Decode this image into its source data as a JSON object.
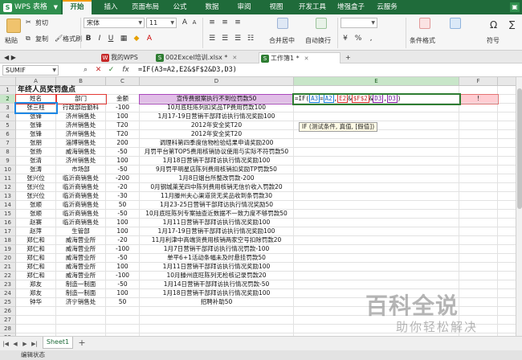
{
  "app": {
    "name": "WPS 表格",
    "menu_tabs": [
      "开始",
      "插入",
      "页面布局",
      "公式",
      "数据",
      "审阅",
      "视图",
      "开发工具",
      "增强盒子",
      "云服务"
    ],
    "active_tab": "开始"
  },
  "ribbon": {
    "cut": "剪切",
    "copy": "复制",
    "format_painter": "格式刷",
    "paste": "粘贴",
    "font_name": "宋体",
    "font_size": "11",
    "merge_center": "合并居中",
    "wrap": "自动换行",
    "cond_format": "条件格式",
    "symbol": "符号",
    "bold": "B",
    "italic": "I",
    "underline": "U"
  },
  "doc_tabs": [
    "我的WPS",
    "002Excel培训.xlsx *",
    "工作簿1 *"
  ],
  "formula_bar": {
    "name_box": "SUMIF",
    "formula": "=IF(A3=A2,E2&$F$2&D3,D3)"
  },
  "columns": [
    "A",
    "B",
    "C",
    "D",
    "E",
    "F"
  ],
  "sheet": {
    "title": "年终人员奖罚盘点",
    "headers": {
      "name": "姓名",
      "dept": "部门",
      "amount": "金额",
      "note": "备注",
      "total": "合计"
    },
    "rows": [
      [
        "张三柱",
        "行政部后勤科",
        "-50",
        "宣传费报案执行不到位罚款50"
      ],
      [
        "张三柱",
        "行政部后勤科",
        "-100",
        "10月底旺陈列扣奖品TP费用罚款100"
      ],
      [
        "张锋",
        "济州销售处",
        "100",
        "1月17-19日营销干部拜访执行情况奖励100"
      ],
      [
        "张锋",
        "济州销售处",
        "T20",
        "2012年安全奖T20"
      ],
      [
        "张锋",
        "济州销售处",
        "T20",
        "2012年安全奖T20"
      ],
      [
        "张朋",
        "淄博销售处",
        "200",
        "调理科第四季度信物检验结果申请奖励200"
      ],
      [
        "张扬",
        "威海销售处",
        "-50",
        "月罚平台第TOP5费用核销协议使用与实际不符罚款50"
      ],
      [
        "张清",
        "济州销售处",
        "100",
        "1月18日营销干部拜访执行情况奖励100"
      ],
      [
        "张涛",
        "市场部",
        "-50",
        "9月罚平明星店陈列费用核销扣奖励TP罚款50"
      ],
      [
        "张兴位",
        "临沂商销售处",
        "-200",
        "1月8日烟台所整改罚款-200"
      ],
      [
        "张兴位",
        "临沂商销售处",
        "-20",
        "0月钢城莱芜四中陈列费用核销无信价收入罚款20"
      ],
      [
        "张兴位",
        "临沂商销售处",
        "-30",
        "11月滕州夫心渠道货无奖品收到条罚款30"
      ],
      [
        "张顺",
        "临沂商销售处",
        "50",
        "1月23-25日营销干部拜访执行情况奖励50"
      ],
      [
        "张顺",
        "临沂商销售处",
        "-50",
        "10月底旺陈列专案抽查近数据不一致力度不够罚款50"
      ],
      [
        "赵赛",
        "临沂商销售处",
        "100",
        "1月11日营销干部拜访执行情况奖励100"
      ],
      [
        "赵萍",
        "生管部",
        "100",
        "1月17-19日营销干部拜访执行情况奖励100"
      ],
      [
        "郑仁和",
        "威海营业所",
        "-20",
        "11月利津中高端货费用核销两家空号扣除罚款20"
      ],
      [
        "郑仁和",
        "威海营业所",
        "-100",
        "1月7日营销干部拜访执行情况罚款-100"
      ],
      [
        "郑仁和",
        "威海营业所",
        "-50",
        "单平6+1活动条幅未及时悬挂罚款50"
      ],
      [
        "郑仁和",
        "威海营业所",
        "100",
        "1月11日营销干部拜访执行情况奖励100"
      ],
      [
        "郑仁和",
        "威海营业所",
        "-100",
        "10月滕州底旺陈列无检核记录罚款20"
      ],
      [
        "郑友",
        "制造一制面",
        "-50",
        "1月14日营销干部拜访执行情况罚款-50"
      ],
      [
        "郑友",
        "制造一制面",
        "100",
        "1月18日营销干部拜访执行情况奖励100"
      ],
      [
        "钟华",
        "济宁销售处",
        "50",
        "招聘补助50"
      ]
    ]
  },
  "tooltip": "IF (测试条件, 真值, [假值])",
  "cell_e2_parts": {
    "p1": "=IF(",
    "r1": "A3",
    "p2": "=",
    "r2": "A2",
    "p3": ",",
    "r3": "E2",
    "p4": "&",
    "r4": "$F$2",
    "p5": "&",
    "r5": "D3",
    "p6": ",",
    "r6": "D3",
    "p7": ")"
  },
  "cell_f2": "!",
  "sheet_tab": "Sheet1",
  "status": "编辑状态",
  "watermark": {
    "main": "百科全说",
    "sub": "助你轻松解决"
  },
  "colors": {
    "brand": "#1f6b3a",
    "accent": "#f39c12",
    "selection": "#c8e6c9"
  }
}
